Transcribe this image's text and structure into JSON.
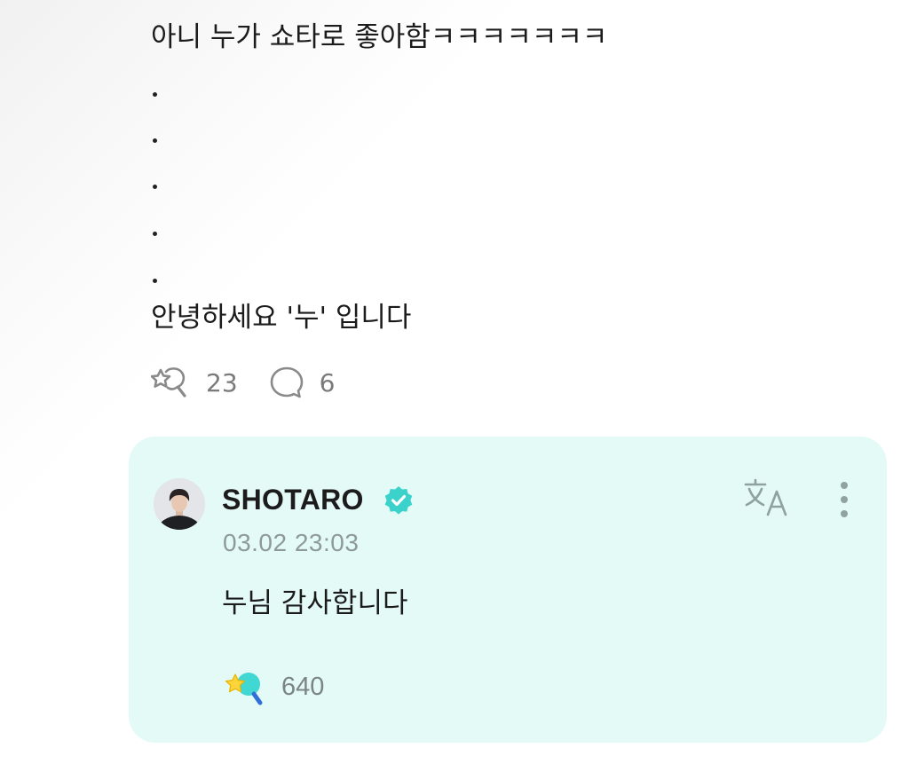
{
  "post": {
    "lines": [
      "아니 누가 쇼타로 좋아함ㅋㅋㅋㅋㅋㅋㅋ",
      "안녕하세요 '누' 입니다"
    ],
    "reaction_count": "23",
    "comment_count": "6"
  },
  "reply": {
    "author": "SHOTARO",
    "timestamp": "03.02 23:03",
    "text": "누님 감사합니다",
    "reaction_count": "640",
    "colors": {
      "card_bg": "#e4faf6",
      "verified": "#3cd2cc",
      "icon_gray": "#8fa29f"
    },
    "icons": [
      "verified-badge-icon",
      "translate-icon",
      "more-vertical-icon",
      "star-wand-reaction-icon"
    ]
  }
}
